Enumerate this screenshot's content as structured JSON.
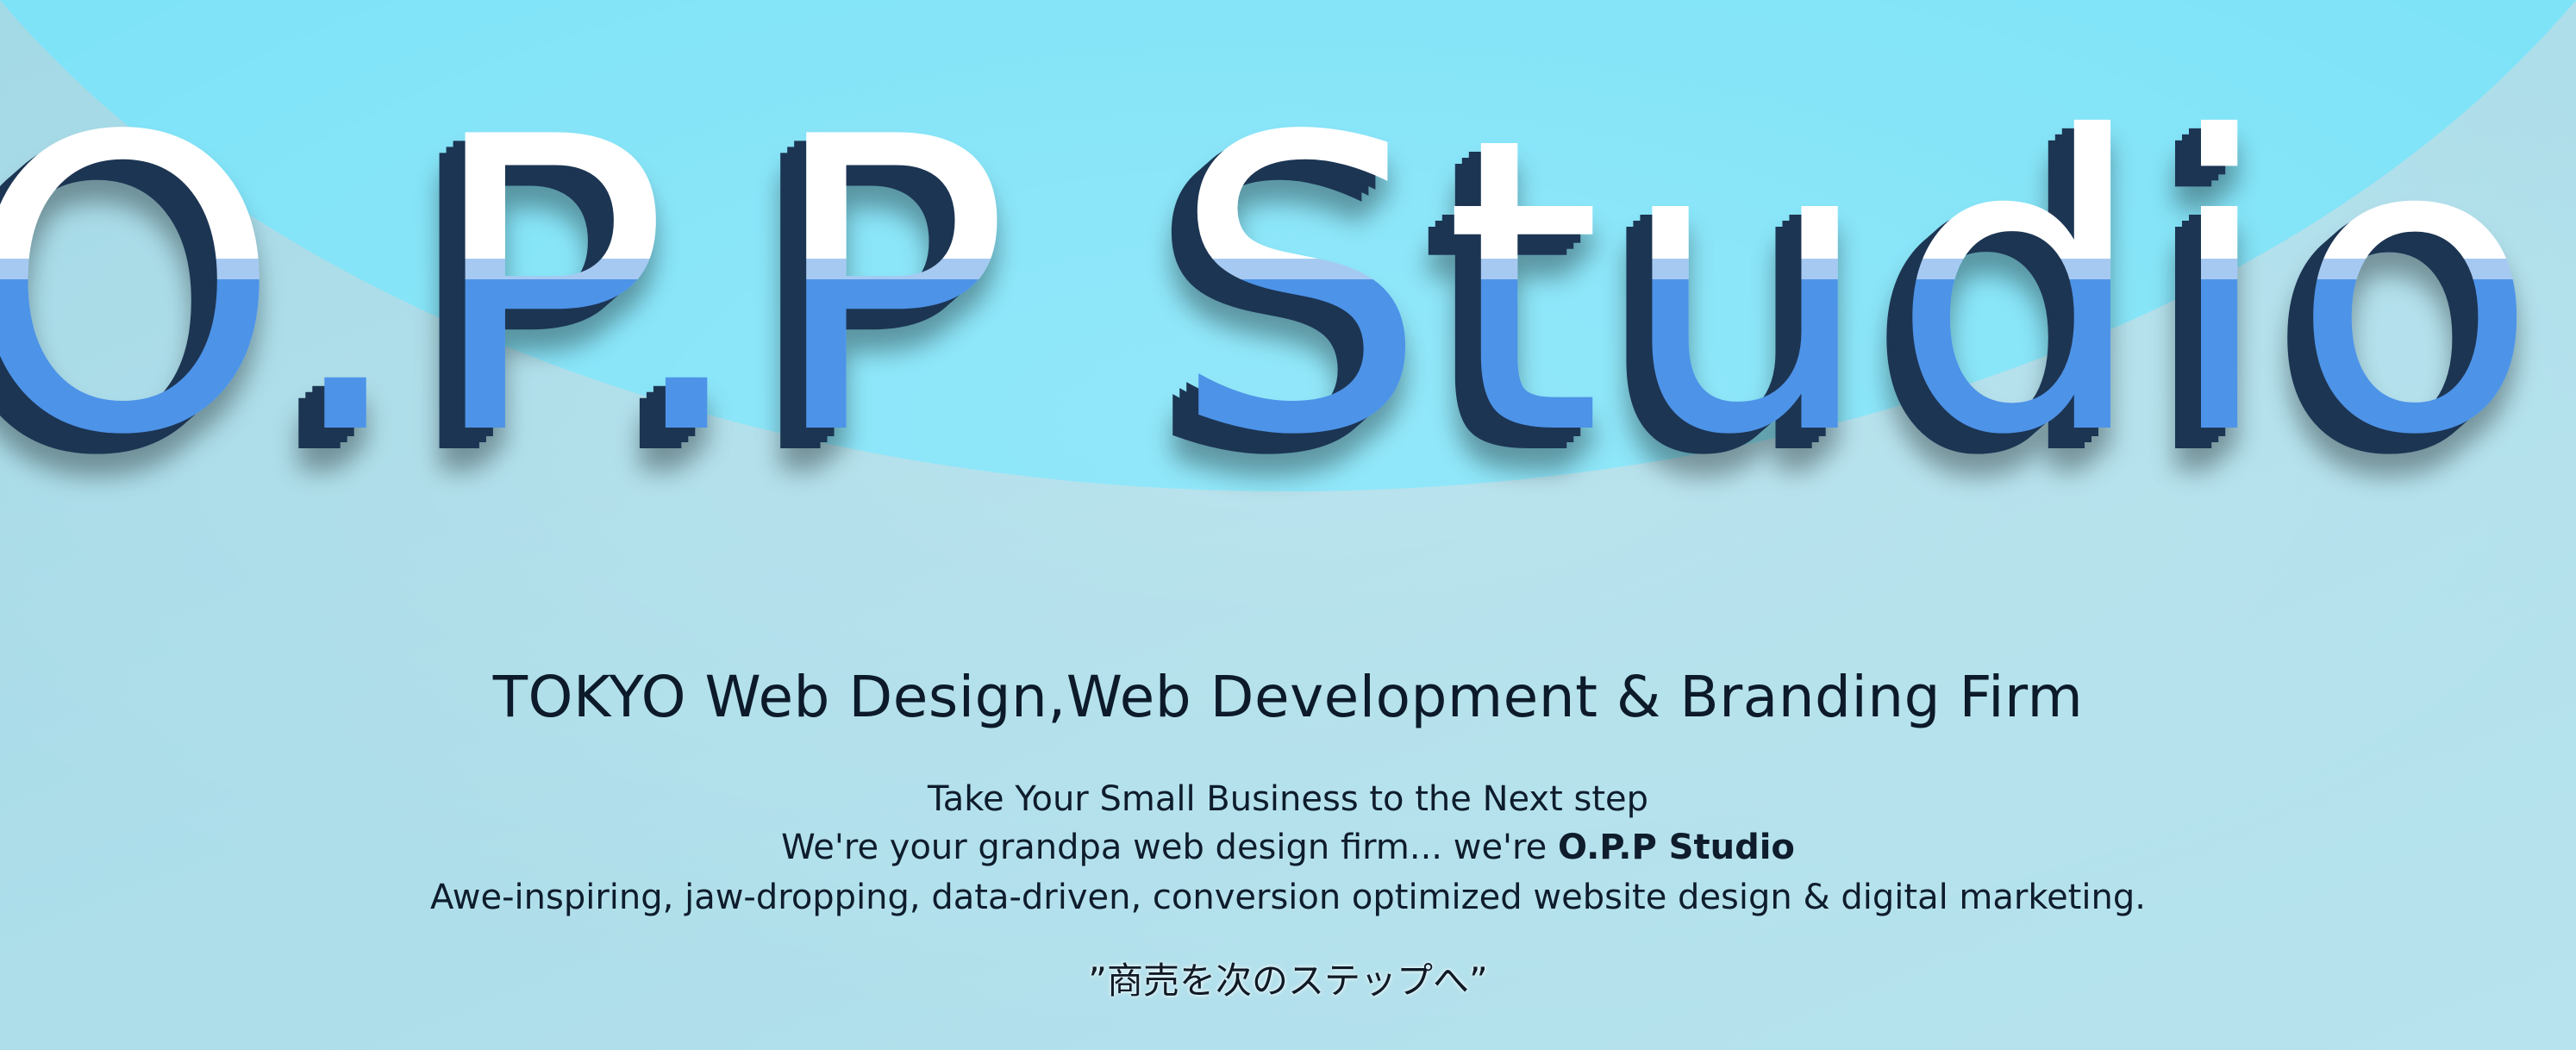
{
  "hero": {
    "logo_text": "O.P.P Studio",
    "tagline": "TOKYO Web Design,Web Development & Branding Firm",
    "line1": "Take Your Small Business to the Next step",
    "line2_prefix": "We're your grandpa web design firm... we're ",
    "line2_brand": "O.P.P Studio",
    "line3": "Awe-inspiring, jaw-dropping, data-driven, conversion optimized website design & digital marketing.",
    "japanese_quote": "”商売を次のステップへ”"
  },
  "colors": {
    "background": "#a9dce8",
    "circle": "#7fe3f8",
    "logo_top": "#ffffff",
    "logo_band": "#9fc5f0",
    "logo_bottom": "#4d93e8",
    "logo_shadow": "#1f3652"
  }
}
